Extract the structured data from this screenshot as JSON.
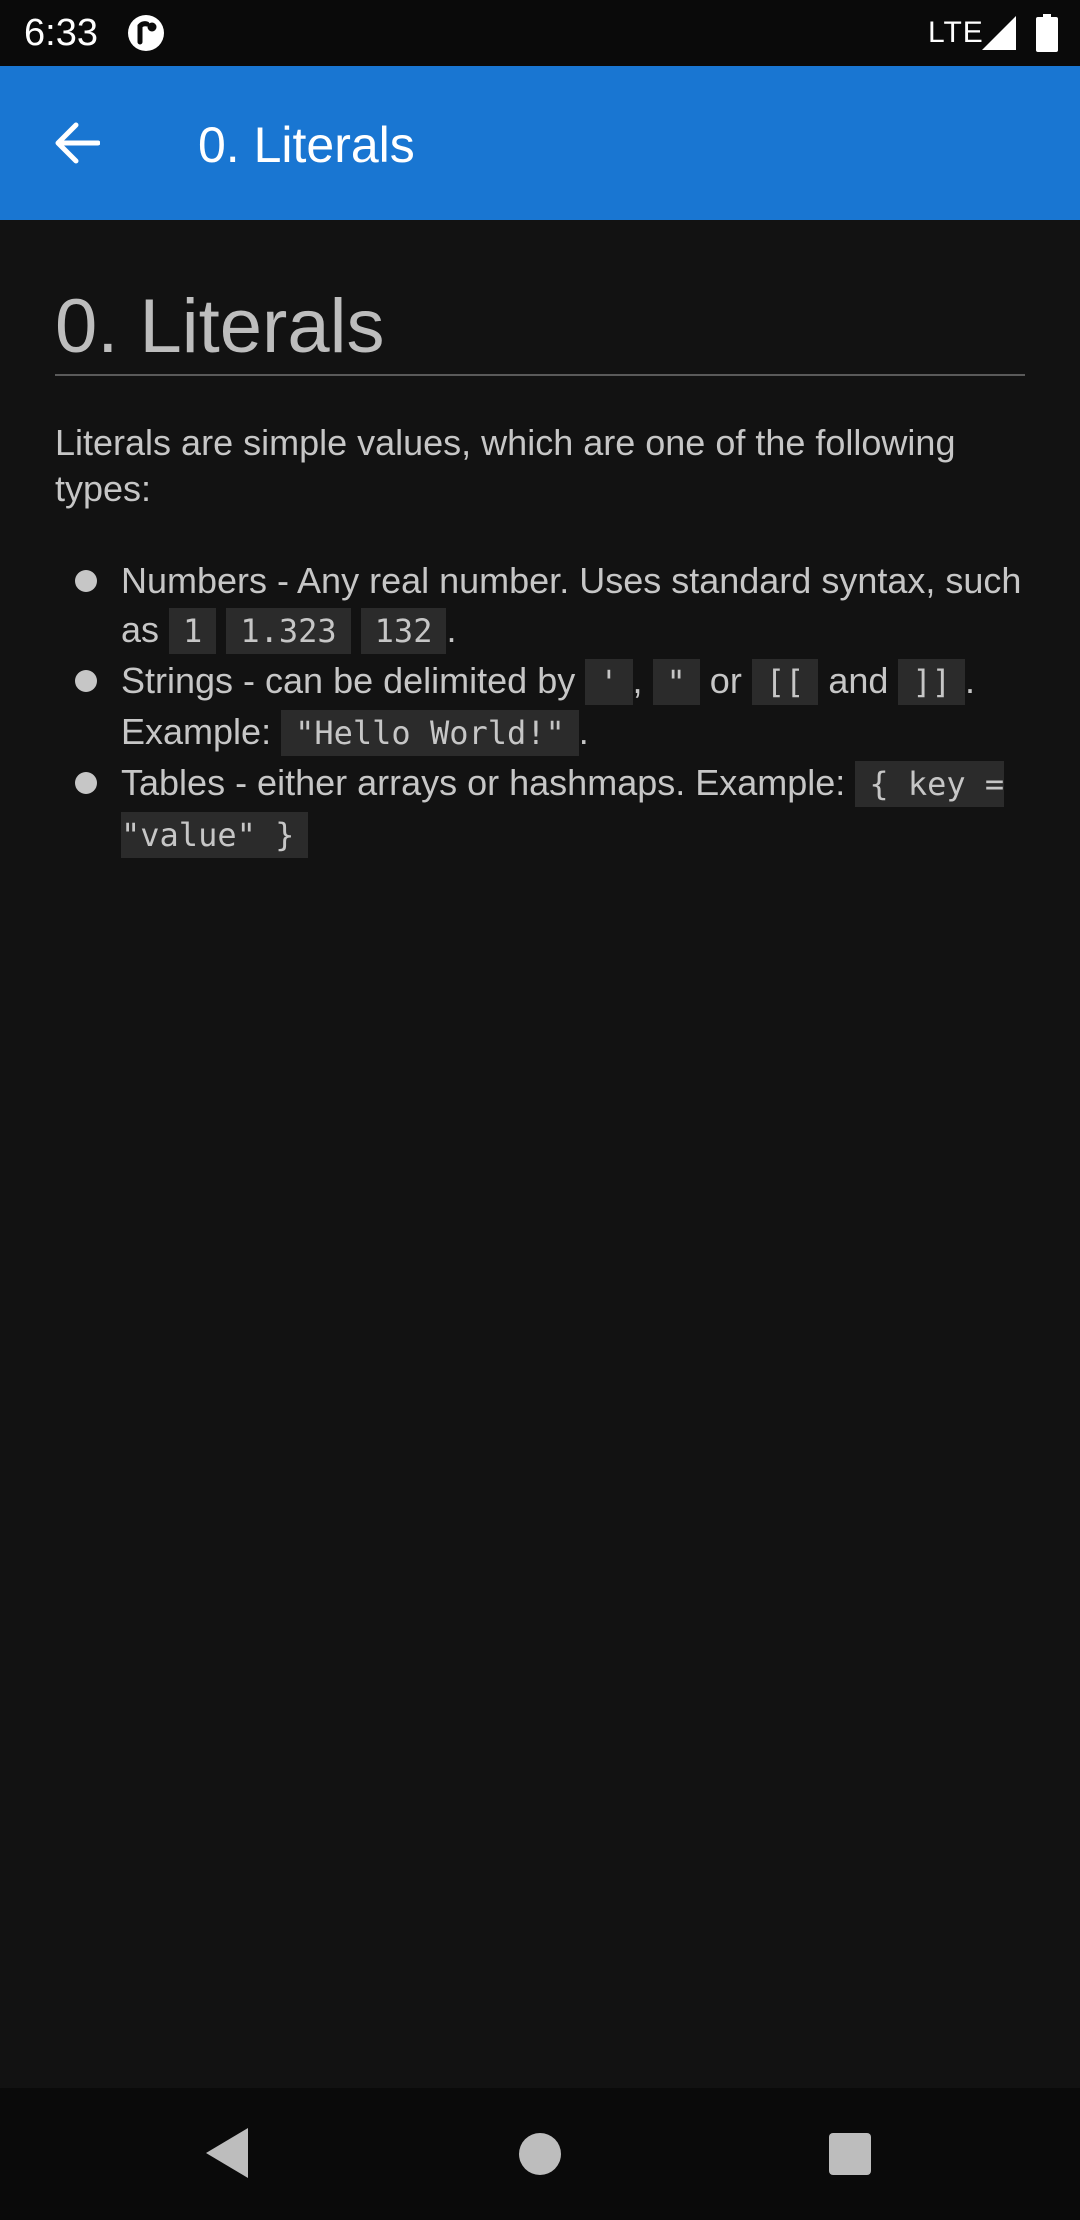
{
  "status_bar": {
    "time": "6:33",
    "network": "LTE",
    "icons": [
      "app-notification-icon",
      "signal-icon",
      "battery-icon"
    ]
  },
  "app_bar": {
    "title": "0. Literals",
    "back_icon": "arrow-left-icon",
    "color": "#1976d2"
  },
  "content": {
    "heading": "0. Literals",
    "intro": "Literals are simple values, which are one of the following types:",
    "items": [
      {
        "text_1": "Numbers - Any real number. Uses standard syntax, such as ",
        "code_1": "1",
        "code_2": "1.323",
        "code_3": "132",
        "text_end": "."
      },
      {
        "text_1": "Strings - can be delimited by ",
        "code_1": "'",
        "sep_1": ",",
        "code_2": "\"",
        "sep_2": " or ",
        "code_3": "[[",
        "sep_3": " and",
        "code_4": "]]",
        "text_2": ". Example: ",
        "code_5": "\"Hello World!\"",
        "text_end": "."
      },
      {
        "text_1": "Tables - either arrays or hashmaps. Example: ",
        "code_1": "{ key = \"value\" }"
      }
    ]
  },
  "nav_bar": {
    "icons": [
      "nav-back-icon",
      "nav-home-icon",
      "nav-recents-icon"
    ]
  },
  "colors": {
    "background": "#121212",
    "text": "#c6c6c6",
    "code_background": "#2b2b2b",
    "accent": "#1976d2"
  }
}
